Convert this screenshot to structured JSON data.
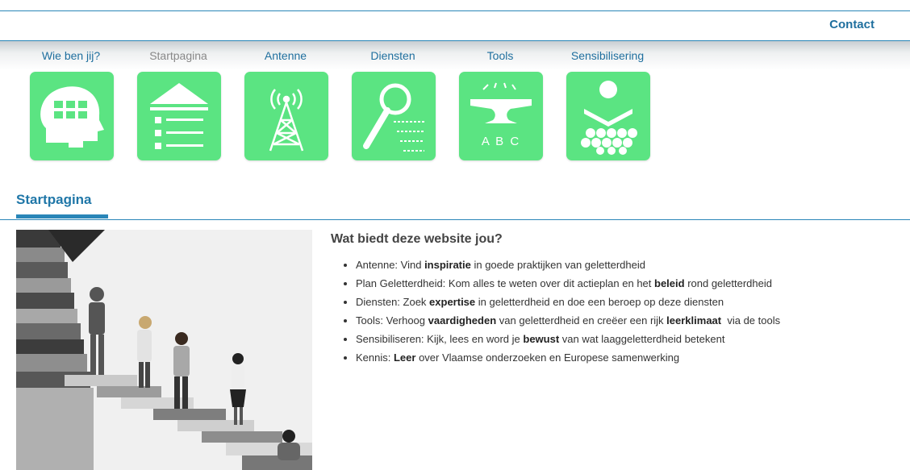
{
  "header": {
    "contact_label": "Contact"
  },
  "nav": {
    "items": [
      {
        "label": "Wie ben jij?",
        "icon": "head-grid-icon",
        "active": false
      },
      {
        "label": "Startpagina",
        "icon": "home-list-icon",
        "active": true
      },
      {
        "label": "Antenne",
        "icon": "antenna-tower-icon",
        "active": false
      },
      {
        "label": "Diensten",
        "icon": "magnifier-list-icon",
        "active": false
      },
      {
        "label": "Tools",
        "icon": "anvil-abc-icon",
        "active": false
      },
      {
        "label": "Sensibilisering",
        "icon": "people-group-icon",
        "active": false
      }
    ],
    "tile_icon_text": "A B C"
  },
  "section": {
    "title": "Startpagina"
  },
  "main": {
    "heading": "Wat biedt deze website jou?",
    "bullets": [
      {
        "pre": "Antenne: Vind ",
        "bold": "inspiratie",
        "post": " in goede praktijken van geletterdheid"
      },
      {
        "pre": "Plan Geletterdheid: Kom alles te weten over dit actieplan en het ",
        "bold": "beleid",
        "post": " rond geletterdheid"
      },
      {
        "pre": "Diensten: Zoek ",
        "bold": "expertise",
        "post": " in geletterdheid en doe een beroep op deze diensten"
      },
      {
        "pre": "Tools: Verhoog ",
        "bold": "vaardigheden",
        "post": " van geletterdheid en creëer een rijk ",
        "bold2": "leerklimaat",
        "post2": "  via de tools"
      },
      {
        "pre": "Sensibiliseren: Kijk, lees en word je ",
        "bold": "bewust",
        "post": " van wat laaggeletterdheid betekent"
      },
      {
        "pre": "Kennis: ",
        "bold": "Leer",
        "post": " over Vlaamse onderzoeken en Europese samenwerking"
      }
    ]
  },
  "colors": {
    "accent": "#2a86b8",
    "link": "#1f6f9e",
    "tile": "#5be482"
  }
}
